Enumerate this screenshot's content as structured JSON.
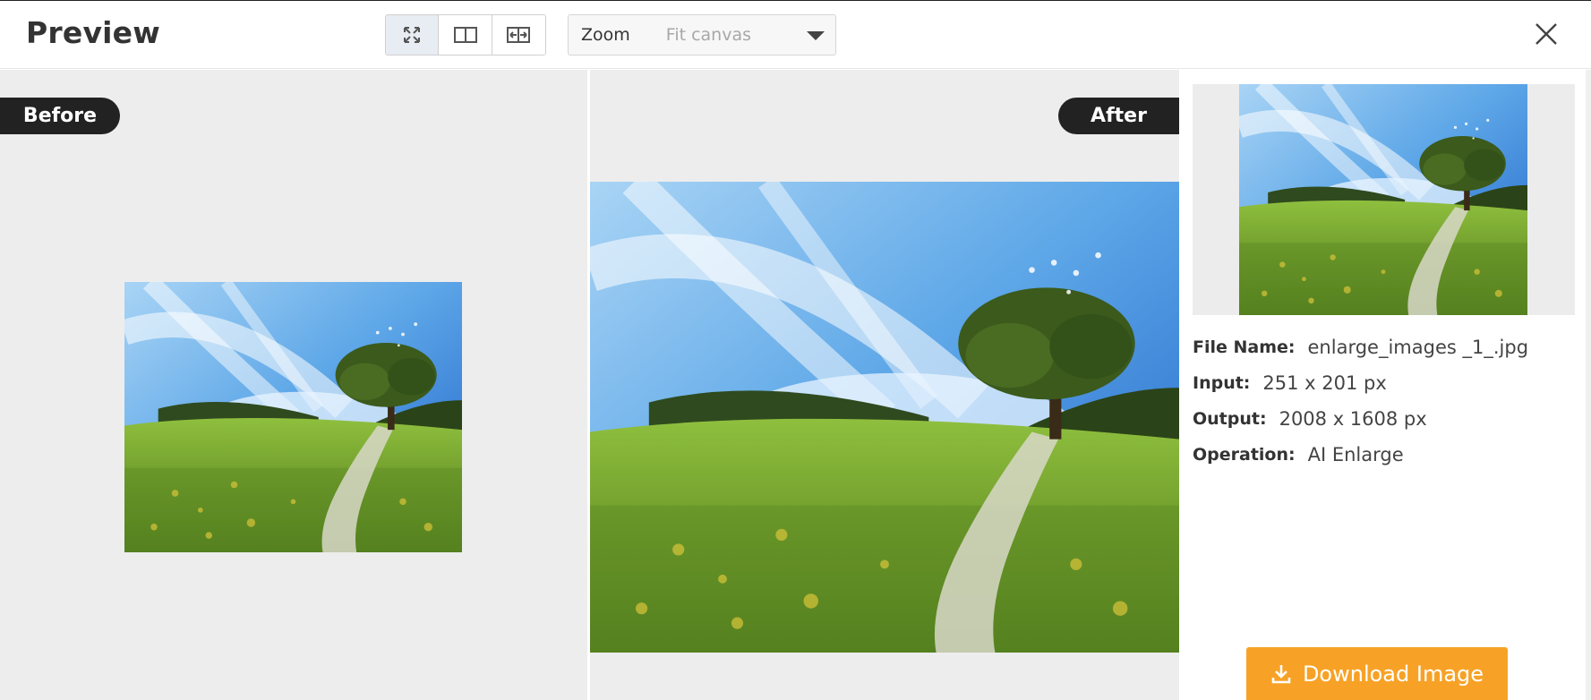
{
  "header": {
    "title": "Preview",
    "view_modes": [
      {
        "icon": "fit-screen-icon",
        "active": true
      },
      {
        "icon": "split-view-icon",
        "active": false
      },
      {
        "icon": "compare-slider-icon",
        "active": false
      }
    ],
    "zoom": {
      "label": "Zoom",
      "value": "Fit canvas"
    },
    "close_icon": "close-icon"
  },
  "before": {
    "badge": "Before"
  },
  "after": {
    "badge": "After"
  },
  "info": {
    "file_name_label": "File Name:",
    "file_name": "enlarge_images _1_.jpg",
    "input_label": "Input:",
    "input": "251 x 201 px",
    "output_label": "Output:",
    "output": "2008 x 1608 px",
    "operation_label": "Operation:",
    "operation": "AI Enlarge"
  },
  "download": {
    "label": "Download Image",
    "icon": "download-icon"
  },
  "colors": {
    "accent": "#f7a226",
    "badge": "#222222",
    "pane_bg": "#ededed"
  }
}
